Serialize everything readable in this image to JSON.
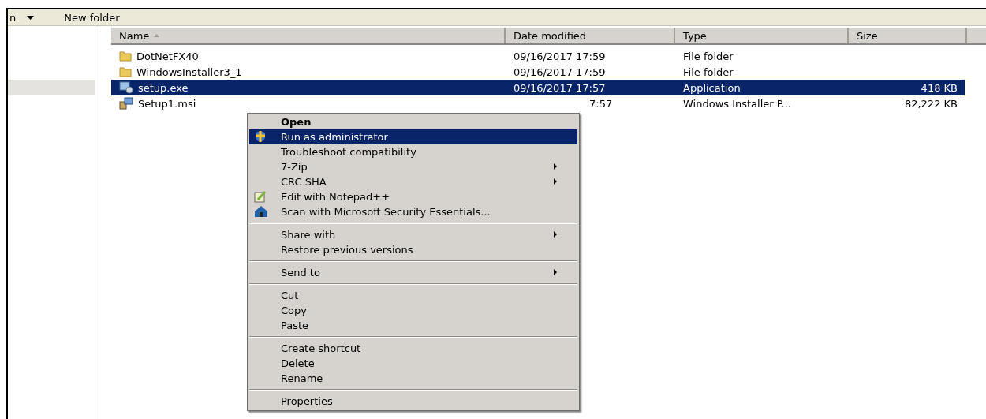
{
  "toolbar": {
    "menu_fragment": "n",
    "new_folder": "New folder"
  },
  "columns": [
    {
      "label": "Name",
      "sorted": true
    },
    {
      "label": "Date modified",
      "sorted": false
    },
    {
      "label": "Type",
      "sorted": false
    },
    {
      "label": "Size",
      "sorted": false
    }
  ],
  "rows": [
    {
      "kind": "folder",
      "name": "DotNetFX40",
      "date": "09/16/2017 17:59",
      "type": "File folder",
      "size": "",
      "selected": false
    },
    {
      "kind": "folder",
      "name": "WindowsInstaller3_1",
      "date": "09/16/2017 17:59",
      "type": "File folder",
      "size": "",
      "selected": false
    },
    {
      "kind": "exe",
      "name": "setup.exe",
      "date": "09/16/2017 17:57",
      "type": "Application",
      "size": "418 KB",
      "selected": true
    },
    {
      "kind": "msi",
      "name": "Setup1.msi",
      "date": "7:57",
      "type": "Windows Installer P...",
      "size": "82,222 KB",
      "selected": false
    }
  ],
  "context_menu": [
    {
      "kind": "default",
      "label": "Open",
      "selected": false,
      "submenu": false
    },
    {
      "kind": "shield",
      "label": "Run as administrator",
      "selected": true,
      "submenu": false
    },
    {
      "kind": "plain",
      "label": "Troubleshoot compatibility",
      "selected": false,
      "submenu": false
    },
    {
      "kind": "plain",
      "label": "7-Zip",
      "selected": false,
      "submenu": true
    },
    {
      "kind": "plain",
      "label": "CRC SHA",
      "selected": false,
      "submenu": true
    },
    {
      "kind": "notepad",
      "label": "Edit with Notepad++",
      "selected": false,
      "submenu": false
    },
    {
      "kind": "scan",
      "label": "Scan with Microsoft Security Essentials...",
      "selected": false,
      "submenu": false
    },
    {
      "kind": "separator"
    },
    {
      "kind": "plain",
      "label": "Share with",
      "selected": false,
      "submenu": true
    },
    {
      "kind": "plain",
      "label": "Restore previous versions",
      "selected": false,
      "submenu": false
    },
    {
      "kind": "separator"
    },
    {
      "kind": "plain",
      "label": "Send to",
      "selected": false,
      "submenu": true
    },
    {
      "kind": "separator"
    },
    {
      "kind": "plain",
      "label": "Cut",
      "selected": false,
      "submenu": false
    },
    {
      "kind": "plain",
      "label": "Copy",
      "selected": false,
      "submenu": false
    },
    {
      "kind": "plain",
      "label": "Paste",
      "selected": false,
      "submenu": false
    },
    {
      "kind": "separator"
    },
    {
      "kind": "plain",
      "label": "Create shortcut",
      "selected": false,
      "submenu": false
    },
    {
      "kind": "plain",
      "label": "Delete",
      "selected": false,
      "submenu": false
    },
    {
      "kind": "plain",
      "label": "Rename",
      "selected": false,
      "submenu": false
    },
    {
      "kind": "separator"
    },
    {
      "kind": "plain",
      "label": "Properties",
      "selected": false,
      "submenu": false
    }
  ]
}
